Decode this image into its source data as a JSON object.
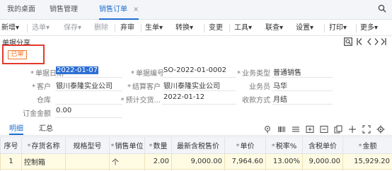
{
  "tabs": [
    {
      "label": "我的桌面"
    },
    {
      "label": "销售管理"
    },
    {
      "label": "销售订单",
      "close": "×"
    }
  ],
  "toolbar": {
    "new": "新增",
    "new_arrow": "▾",
    "select": "选单",
    "select_arrow": "▾",
    "save": "保存",
    "save_arrow": "▾",
    "delete": "删除",
    "abandon": "弃审",
    "generate": "生单",
    "generate_arrow": "▾",
    "convert": "转换",
    "convert_arrow": "▾",
    "change": "变更",
    "tools": "工具",
    "tools_arrow": "▾",
    "query": "联查",
    "query_arrow": "▾",
    "settings": "设置",
    "settings_arrow": "▾",
    "print": "打印",
    "print_arrow": "▾",
    "more": "更多",
    "more_arrow": "▾"
  },
  "header": {
    "share_label": "单据分享",
    "status": "已审",
    "fields": {
      "doc_date_label": "单据日期",
      "doc_date": "2022-01-07",
      "doc_no_label": "单据编号",
      "doc_no": "SO-2022-01-0002",
      "biz_type_label": "业务类型",
      "biz_type": "普通销售",
      "customer_label": "客户",
      "customer": "银川泰隆实业公司",
      "settle_customer_label": "结算客户",
      "settle_customer": "银川泰隆实业公司",
      "salesman_label": "业务员",
      "salesman": "马华",
      "warehouse_label": "仓库",
      "expected_date_label": "预计交货...",
      "expected_date": "2022-01-12",
      "collection_label": "收款方式",
      "collection": "月结",
      "deposit_label": "订金金额",
      "deposit": "0.00"
    }
  },
  "detail_tabs": {
    "detail": "明细",
    "summary": "汇总"
  },
  "table": {
    "columns": [
      "序号",
      "存货名称",
      "规格型号",
      "销售单位",
      "数量",
      "最新含税售价",
      "单价",
      "税率%",
      "含税单价",
      "金额"
    ],
    "required": [
      false,
      true,
      false,
      true,
      true,
      false,
      true,
      true,
      false,
      true
    ],
    "rows": [
      [
        "1",
        "控制箱",
        "",
        "个",
        "2.00",
        "9,000.00",
        "7,964.60",
        "13.00%",
        "9,000.00",
        "15,929.20"
      ]
    ]
  }
}
